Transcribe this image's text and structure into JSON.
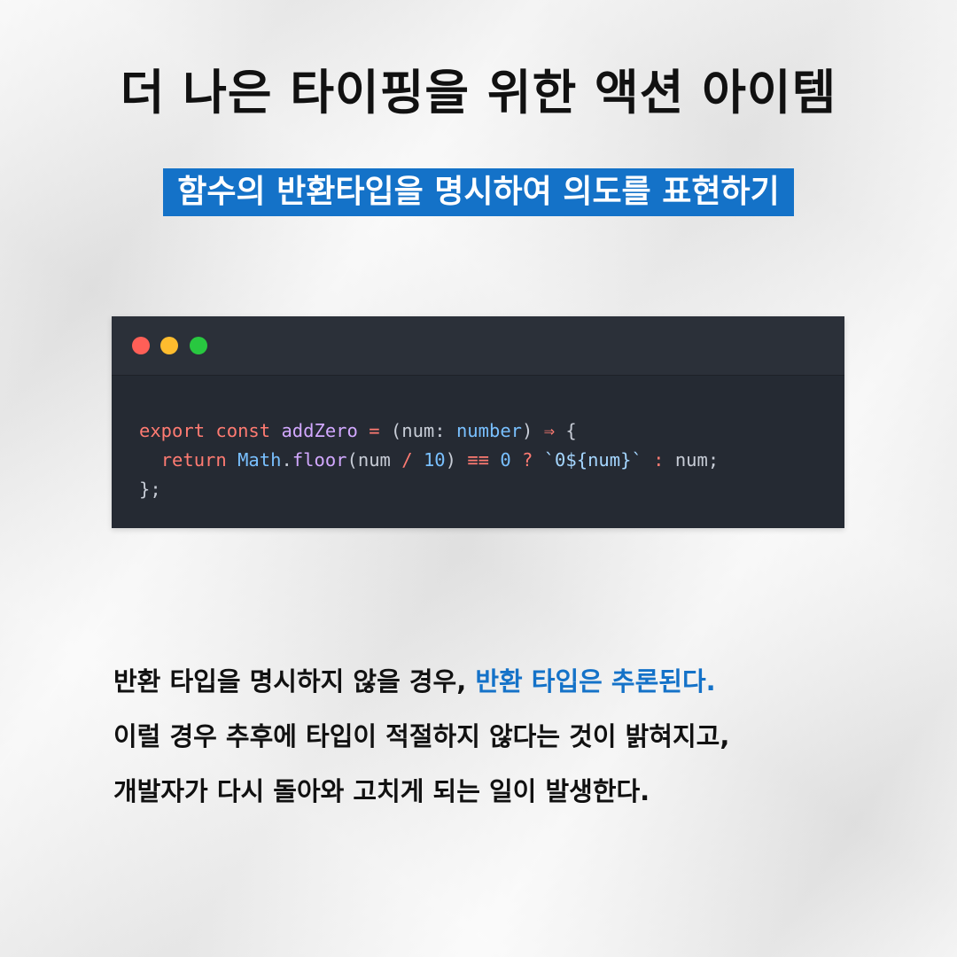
{
  "title": "더 나은 타이핑을 위한 액션 아이템",
  "subtitle": "함수의 반환타입을 명시하여 의도를 표현하기",
  "code_window": {
    "dots": [
      "red",
      "yellow",
      "green"
    ],
    "colors": {
      "background": "#252a33",
      "keyword": "#ff7b72",
      "function": "#d2a8ff",
      "type": "#79c0ff",
      "string": "#a5d6ff",
      "text": "#c7ccd6"
    },
    "line1": [
      {
        "t": "export",
        "c": "tok-kw"
      },
      {
        "t": " ",
        "c": "tok-plain"
      },
      {
        "t": "const",
        "c": "tok-kw"
      },
      {
        "t": " ",
        "c": "tok-plain"
      },
      {
        "t": "addZero",
        "c": "tok-def"
      },
      {
        "t": " ",
        "c": "tok-plain"
      },
      {
        "t": "=",
        "c": "tok-op"
      },
      {
        "t": " (",
        "c": "tok-plain"
      },
      {
        "t": "num",
        "c": "tok-plain"
      },
      {
        "t": ": ",
        "c": "tok-plain"
      },
      {
        "t": "number",
        "c": "tok-type"
      },
      {
        "t": ") ",
        "c": "tok-plain"
      },
      {
        "t": "⇒",
        "c": "tok-op"
      },
      {
        "t": " {",
        "c": "tok-plain"
      }
    ],
    "line2": [
      {
        "t": "  ",
        "c": "tok-plain"
      },
      {
        "t": "return",
        "c": "tok-kw"
      },
      {
        "t": " ",
        "c": "tok-plain"
      },
      {
        "t": "Math",
        "c": "tok-type"
      },
      {
        "t": ".",
        "c": "tok-plain"
      },
      {
        "t": "floor",
        "c": "tok-fn"
      },
      {
        "t": "(num ",
        "c": "tok-plain"
      },
      {
        "t": "/",
        "c": "tok-op"
      },
      {
        "t": " ",
        "c": "tok-plain"
      },
      {
        "t": "10",
        "c": "tok-num"
      },
      {
        "t": ") ",
        "c": "tok-plain"
      },
      {
        "t": "≡≡",
        "c": "tok-op"
      },
      {
        "t": " ",
        "c": "tok-plain"
      },
      {
        "t": "0",
        "c": "tok-num"
      },
      {
        "t": " ",
        "c": "tok-plain"
      },
      {
        "t": "?",
        "c": "tok-op"
      },
      {
        "t": " ",
        "c": "tok-plain"
      },
      {
        "t": "`0${num}`",
        "c": "tok-str"
      },
      {
        "t": " ",
        "c": "tok-plain"
      },
      {
        "t": ":",
        "c": "tok-op"
      },
      {
        "t": " num;",
        "c": "tok-plain"
      }
    ],
    "line3": [
      {
        "t": "};",
        "c": "tok-plain"
      }
    ]
  },
  "body": {
    "line1_a": "반환 타입을 명시하지 않을 경우, ",
    "line1_highlight": "반환 타입은 추론된다.",
    "line2": "이럴 경우 추후에 타입이 적절하지 않다는 것이 밝혀지고,",
    "line3": "개발자가 다시 돌아와 고치게 되는 일이 발생한다.",
    "highlight_color": "#1472c8"
  },
  "accent_color": "#1472c8"
}
